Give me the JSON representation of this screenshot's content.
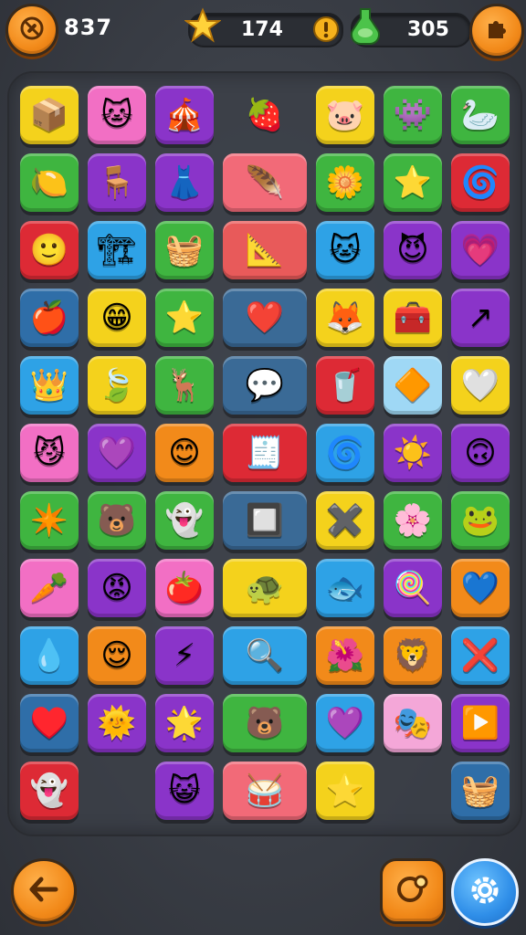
{
  "hud": {
    "moves": "837",
    "stars": "174",
    "gems": "305"
  },
  "icons": {
    "top_left": "no-tools-icon",
    "star": "star-icon",
    "alert": "exclamation-icon",
    "potion": "green-potion-icon",
    "top_right": "puzzle-piece-icon",
    "bottom_left": "back-arrow-icon",
    "bottom_middle": "hint-bubble-icon",
    "bottom_right": "settings-gear-icon"
  },
  "colors": {
    "orange_button": "#f28a1a",
    "blue_button": "#2f8ee8",
    "board_bg": "#3c4048"
  },
  "tiles": [
    {
      "row": 0,
      "col": 0,
      "color": "#f4d21c",
      "glyph": "📦",
      "icon": "purple-box-icon"
    },
    {
      "row": 0,
      "col": 1,
      "color": "#f26fc4",
      "glyph": "🐱",
      "icon": "blue-cat-face-icon"
    },
    {
      "row": 0,
      "col": 2,
      "color": "#8a34c9",
      "glyph": "🎪",
      "icon": "circus-tent-icon"
    },
    {
      "row": 0,
      "col": 3,
      "color": "transparent",
      "glyph": "🍓",
      "icon": "red-berry-icon",
      "wide": true
    },
    {
      "row": 0,
      "col": 4,
      "color": "#f4d21c",
      "glyph": "🐷",
      "icon": "pink-pig-face-icon"
    },
    {
      "row": 0,
      "col": 5,
      "color": "#3fb540",
      "glyph": "👾",
      "icon": "purple-blob-monster-icon"
    },
    {
      "row": 0,
      "col": 6,
      "color": "#3fb540",
      "glyph": "🦢",
      "icon": "white-bird-icon"
    },
    {
      "row": 1,
      "col": 0,
      "color": "#3fb540",
      "glyph": "🍋",
      "icon": "yellow-leaf-icon"
    },
    {
      "row": 1,
      "col": 1,
      "color": "#8a34c9",
      "glyph": "🪑",
      "icon": "blue-cart-icon"
    },
    {
      "row": 1,
      "col": 2,
      "color": "#8a34c9",
      "glyph": "👗",
      "icon": "purple-dress-icon"
    },
    {
      "row": 1,
      "col": 3,
      "color": "#f26a78",
      "glyph": "🪶",
      "icon": "feather-quill-icon",
      "wide": true
    },
    {
      "row": 1,
      "col": 4,
      "color": "#3fb540",
      "glyph": "🌼",
      "icon": "white-flower-icon"
    },
    {
      "row": 1,
      "col": 5,
      "color": "#3fb540",
      "glyph": "⭐",
      "icon": "flower-star-icon"
    },
    {
      "row": 1,
      "col": 6,
      "color": "#dd2a35",
      "glyph": "🌀",
      "icon": "blue-spiral-icon"
    },
    {
      "row": 2,
      "col": 0,
      "color": "#dd2a35",
      "glyph": "🙂",
      "icon": "yellow-smiley-icon"
    },
    {
      "row": 2,
      "col": 1,
      "color": "#2ea2e6",
      "glyph": "🏗",
      "icon": "yellow-crane-icon"
    },
    {
      "row": 2,
      "col": 2,
      "color": "#3fb540",
      "glyph": "🧺",
      "icon": "green-basket-icon"
    },
    {
      "row": 2,
      "col": 3,
      "color": "#e85a5a",
      "glyph": "📐",
      "icon": "green-ruler-icon",
      "wide": true
    },
    {
      "row": 2,
      "col": 4,
      "color": "#2ea2e6",
      "glyph": "🐱",
      "icon": "yellow-cat-face-icon"
    },
    {
      "row": 2,
      "col": 5,
      "color": "#8a34c9",
      "glyph": "😈",
      "icon": "purple-cat-face-icon"
    },
    {
      "row": 2,
      "col": 6,
      "color": "#8a34c9",
      "glyph": "💗",
      "icon": "pink-heart-icon"
    },
    {
      "row": 3,
      "col": 0,
      "color": "#2f6ea8",
      "glyph": "🍎",
      "icon": "red-apple-icon"
    },
    {
      "row": 3,
      "col": 1,
      "color": "#f4d21c",
      "glyph": "😁",
      "icon": "grinning-face-icon"
    },
    {
      "row": 3,
      "col": 2,
      "color": "#3fb540",
      "glyph": "⭐",
      "icon": "blue-star-icon"
    },
    {
      "row": 3,
      "col": 3,
      "color": "#3a6a96",
      "glyph": "❤️",
      "icon": "red-heart-face-icon",
      "wide": true
    },
    {
      "row": 3,
      "col": 4,
      "color": "#f4d21c",
      "glyph": "🦊",
      "icon": "fox-face-icon"
    },
    {
      "row": 3,
      "col": 5,
      "color": "#f4d21c",
      "glyph": "🧰",
      "icon": "toolbox-icon"
    },
    {
      "row": 3,
      "col": 6,
      "color": "#8a34c9",
      "glyph": "↗",
      "icon": "yellow-arrow-icon"
    },
    {
      "row": 4,
      "col": 0,
      "color": "#2ea2e6",
      "glyph": "👑",
      "icon": "purple-crown-face-icon"
    },
    {
      "row": 4,
      "col": 1,
      "color": "#f4d21c",
      "glyph": "🍃",
      "icon": "green-leaf-icon"
    },
    {
      "row": 4,
      "col": 2,
      "color": "#3fb540",
      "glyph": "🦌",
      "icon": "deer-face-icon"
    },
    {
      "row": 4,
      "col": 3,
      "color": "#3a6a96",
      "glyph": "💬",
      "icon": "blue-speech-bubble-icon",
      "wide": true
    },
    {
      "row": 4,
      "col": 4,
      "color": "#dd2a35",
      "glyph": "🥤",
      "icon": "pink-cup-face-icon"
    },
    {
      "row": 4,
      "col": 5,
      "color": "#9fd8f5",
      "glyph": "🔶",
      "icon": "orange-diamond-icon"
    },
    {
      "row": 4,
      "col": 6,
      "color": "#f4d21c",
      "glyph": "🤍",
      "icon": "white-drop-icon"
    },
    {
      "row": 5,
      "col": 0,
      "color": "#f26fc4",
      "glyph": "😼",
      "icon": "purple-cat-face-icon"
    },
    {
      "row": 5,
      "col": 1,
      "color": "#8a34c9",
      "glyph": "💜",
      "icon": "purple-heart-bubble-icon"
    },
    {
      "row": 5,
      "col": 2,
      "color": "#f28a1a",
      "glyph": "😊",
      "icon": "orange-smiley-icon"
    },
    {
      "row": 5,
      "col": 3,
      "color": "#dd2a35",
      "glyph": "🧾",
      "icon": "blue-ticket-icon",
      "wide": true
    },
    {
      "row": 5,
      "col": 4,
      "color": "#2ea2e6",
      "glyph": "🌀",
      "icon": "blue-swirl-icon"
    },
    {
      "row": 5,
      "col": 5,
      "color": "#8a34c9",
      "glyph": "☀️",
      "icon": "sun-icon"
    },
    {
      "row": 5,
      "col": 6,
      "color": "#8a34c9",
      "glyph": "🙃",
      "icon": "orange-mask-face-icon"
    },
    {
      "row": 6,
      "col": 0,
      "color": "#3fb540",
      "glyph": "✴️",
      "icon": "pink-sparkle-icon"
    },
    {
      "row": 6,
      "col": 1,
      "color": "#3fb540",
      "glyph": "🐻",
      "icon": "bear-face-icon"
    },
    {
      "row": 6,
      "col": 2,
      "color": "#3fb540",
      "glyph": "👻",
      "icon": "white-ghost-icon"
    },
    {
      "row": 6,
      "col": 3,
      "color": "#3a6a96",
      "glyph": "🔲",
      "icon": "frame-icon",
      "wide": true
    },
    {
      "row": 6,
      "col": 4,
      "color": "#f4d21c",
      "glyph": "✖️",
      "icon": "crossed-sticks-icon"
    },
    {
      "row": 6,
      "col": 5,
      "color": "#3fb540",
      "glyph": "🌸",
      "icon": "flower-icon"
    },
    {
      "row": 6,
      "col": 6,
      "color": "#3fb540",
      "glyph": "🐸",
      "icon": "green-frog-face-icon"
    },
    {
      "row": 7,
      "col": 0,
      "color": "#f26fc4",
      "glyph": "🥕",
      "icon": "carrot-icon"
    },
    {
      "row": 7,
      "col": 1,
      "color": "#8a34c9",
      "glyph": "😡",
      "icon": "red-monster-icon"
    },
    {
      "row": 7,
      "col": 2,
      "color": "#f26fc4",
      "glyph": "🍅",
      "icon": "tomato-icon"
    },
    {
      "row": 7,
      "col": 3,
      "color": "#f4d21c",
      "glyph": "🐢",
      "icon": "green-turtle-icon",
      "wide": true
    },
    {
      "row": 7,
      "col": 4,
      "color": "#2ea2e6",
      "glyph": "🐟",
      "icon": "white-fish-icon"
    },
    {
      "row": 7,
      "col": 5,
      "color": "#8a34c9",
      "glyph": "🍭",
      "icon": "lollipop-icon"
    },
    {
      "row": 7,
      "col": 6,
      "color": "#f28a1a",
      "glyph": "💙",
      "icon": "blue-heart-icon"
    },
    {
      "row": 8,
      "col": 0,
      "color": "#2ea2e6",
      "glyph": "💧",
      "icon": "water-drop-icon"
    },
    {
      "row": 8,
      "col": 1,
      "color": "#f28a1a",
      "glyph": "😌",
      "icon": "orange-face-icon"
    },
    {
      "row": 8,
      "col": 2,
      "color": "#8a34c9",
      "glyph": "⚡",
      "icon": "lightning-icon"
    },
    {
      "row": 8,
      "col": 3,
      "color": "#2ea2e6",
      "glyph": "🔍",
      "icon": "magnifier-icon",
      "wide": true
    },
    {
      "row": 8,
      "col": 4,
      "color": "#f28a1a",
      "glyph": "🌺",
      "icon": "red-flower-icon"
    },
    {
      "row": 8,
      "col": 5,
      "color": "#f28a1a",
      "glyph": "🦁",
      "icon": "lion-face-icon"
    },
    {
      "row": 8,
      "col": 6,
      "color": "#2ea2e6",
      "glyph": "❌",
      "icon": "yellow-x-icon"
    },
    {
      "row": 9,
      "col": 0,
      "color": "#2f6ea8",
      "glyph": "♥️",
      "icon": "red-heart-icon"
    },
    {
      "row": 9,
      "col": 1,
      "color": "#8a34c9",
      "glyph": "🌞",
      "icon": "sun-face-icon"
    },
    {
      "row": 9,
      "col": 2,
      "color": "#8a34c9",
      "glyph": "🌟",
      "icon": "purple-star-icon"
    },
    {
      "row": 9,
      "col": 3,
      "color": "#3fb540",
      "glyph": "🐻",
      "icon": "teddy-bear-icon",
      "wide": true
    },
    {
      "row": 9,
      "col": 4,
      "color": "#2ea2e6",
      "glyph": "💜",
      "icon": "purple-heart-icon"
    },
    {
      "row": 9,
      "col": 5,
      "color": "#f4a7d8",
      "glyph": "🎭",
      "icon": "pink-box-face-icon"
    },
    {
      "row": 9,
      "col": 6,
      "color": "#8a34c9",
      "glyph": "▶️",
      "icon": "orange-triangle-icon"
    },
    {
      "row": 10,
      "col": 0,
      "color": "#dd2a35",
      "glyph": "👻",
      "icon": "white-ghost-icon"
    },
    {
      "row": 10,
      "col": 2,
      "color": "#8a34c9",
      "glyph": "😺",
      "icon": "purple-blob-face-icon"
    },
    {
      "row": 10,
      "col": 3,
      "color": "#f26a78",
      "glyph": "🥁",
      "icon": "drum-icon",
      "wide": true
    },
    {
      "row": 10,
      "col": 4,
      "color": "#f4d21c",
      "glyph": "⭐",
      "icon": "yellow-star-icon"
    },
    {
      "row": 10,
      "col": 6,
      "color": "#2f6ea8",
      "glyph": "🧺",
      "icon": "orange-basket-icon"
    }
  ]
}
